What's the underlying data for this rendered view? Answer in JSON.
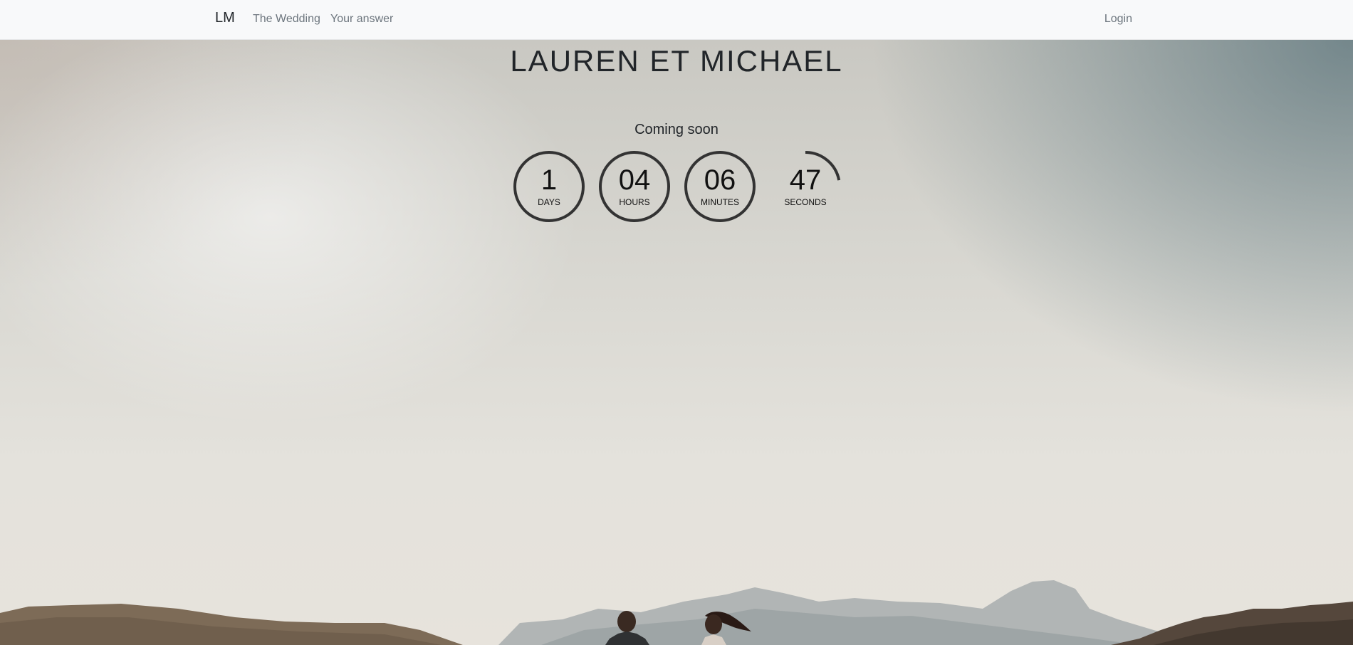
{
  "navbar": {
    "brand": "LM",
    "links": [
      "The Wedding",
      "Your answer"
    ],
    "login": "Login"
  },
  "hero": {
    "title": "LAUREN ET MICHAEL",
    "subtitle": "Coming soon"
  },
  "countdown": [
    {
      "value": "1",
      "label": "DAYS",
      "progress": 1.0
    },
    {
      "value": "04",
      "label": "HOURS",
      "progress": 1.0
    },
    {
      "value": "06",
      "label": "MINUTES",
      "progress": 1.0
    },
    {
      "value": "47",
      "label": "SECONDS",
      "progress": 0.22
    }
  ],
  "colors": {
    "navbar_bg": "#f8f9fa",
    "ring": "#333333",
    "text": "#212529"
  }
}
